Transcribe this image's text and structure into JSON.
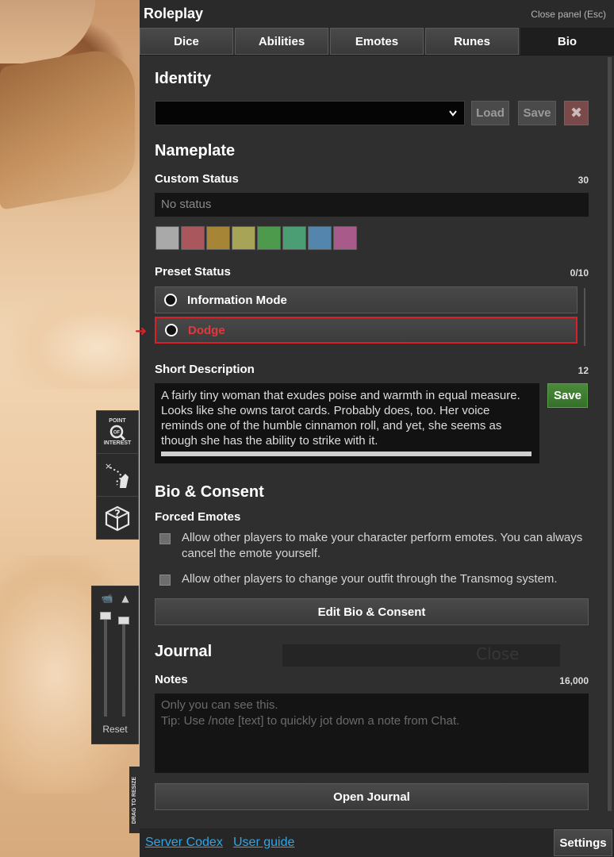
{
  "panel": {
    "title": "Roleplay",
    "close_label": "Close panel (Esc)"
  },
  "tabs": [
    {
      "label": "Dice",
      "active": false
    },
    {
      "label": "Abilities",
      "active": false
    },
    {
      "label": "Emotes",
      "active": false
    },
    {
      "label": "Runes",
      "active": false
    },
    {
      "label": "Bio",
      "active": true
    }
  ],
  "identity": {
    "heading": "Identity",
    "selected": "",
    "load_label": "Load",
    "save_label": "Save",
    "delete_icon": "close-icon"
  },
  "nameplate": {
    "heading": "Nameplate",
    "custom_status_label": "Custom Status",
    "custom_status_count": "30",
    "status_placeholder": "No status",
    "swatch_colors": [
      "#a9a9a9",
      "#a9565c",
      "#a68636",
      "#a8a457",
      "#4d9a4d",
      "#4b9d73",
      "#5486ad",
      "#a85a8a"
    ],
    "preset_status_label": "Preset Status",
    "preset_status_count": "0/10",
    "presets": [
      {
        "label": "Information Mode"
      },
      {
        "label": "Dodge"
      }
    ]
  },
  "short_description": {
    "label": "Short Description",
    "count": "12",
    "text": "A fairly tiny woman that exudes poise and warmth in equal measure. Looks like she owns tarot cards. Probably does, too. Her voice reminds one of the humble cinnamon roll, and yet, she seems as though she has the ability to strike with it.",
    "save_label": "Save"
  },
  "bio_consent": {
    "heading": "Bio & Consent",
    "forced_emotes_label": "Forced Emotes",
    "options": [
      {
        "text": "Allow other players to make your character perform emotes. You can always cancel the emote yourself."
      },
      {
        "text": "Allow other players to change your outfit through the Transmog system."
      }
    ],
    "edit_button": "Edit Bio & Consent"
  },
  "journal": {
    "heading": "Journal",
    "notes_label": "Notes",
    "notes_count": "16,000",
    "notes_placeholder_line1": "Only you can see this.",
    "notes_placeholder_line2": "Tip: Use /note [text] to quickly jot down a note from Chat.",
    "open_button": "Open Journal"
  },
  "footer": {
    "server_codex": "Server Codex",
    "user_guide": "User guide",
    "settings": "Settings"
  },
  "side_tools": {
    "poi_line1": "POINT",
    "poi_line2": "OF",
    "poi_line3": "INTEREST",
    "reset_label": "Reset",
    "drag_label": "DRAG TO RESIZE"
  },
  "background_dialog": {
    "close_text": "Close"
  },
  "colors": {
    "highlight": "#d8202a",
    "link": "#2fa6e8",
    "green_button": "#3f7f33"
  }
}
